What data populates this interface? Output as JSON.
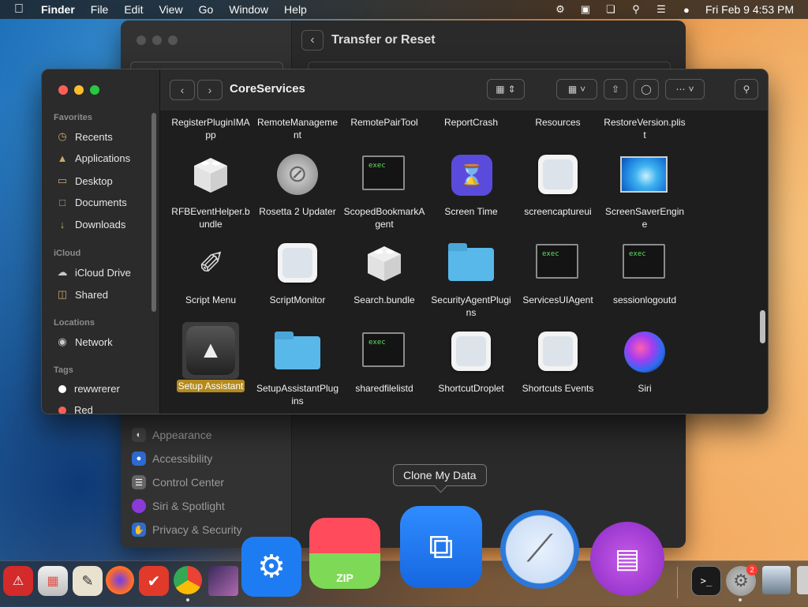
{
  "menubar": {
    "app": "Finder",
    "menus": [
      "File",
      "Edit",
      "View",
      "Go",
      "Window",
      "Help"
    ],
    "clock": "Fri Feb 9  4:53 PM"
  },
  "settings": {
    "title": "Transfer or Reset",
    "items": [
      "Appearance",
      "Accessibility",
      "Control Center",
      "Siri & Spotlight",
      "Privacy & Security"
    ]
  },
  "finder": {
    "title": "CoreServices",
    "sidebar": {
      "favorites_header": "Favorites",
      "favorites": [
        "Recents",
        "Applications",
        "Desktop",
        "Documents",
        "Downloads"
      ],
      "icloud_header": "iCloud",
      "icloud": [
        "iCloud Drive",
        "Shared"
      ],
      "locations_header": "Locations",
      "locations": [
        "Network"
      ],
      "tags_header": "Tags",
      "tags": [
        "rewwrerer",
        "Red"
      ]
    },
    "files_row0": [
      "RegisterPluginIMApp",
      "RemoteManagement",
      "RemotePairTool",
      "ReportCrash",
      "Resources",
      "RestoreVersion.plist"
    ],
    "files_row1": [
      "RFBEventHelper.bundle",
      "Rosetta 2 Updater",
      "ScopedBookmarkAgent",
      "Screen Time",
      "screencaptureui",
      "ScreenSaverEngine"
    ],
    "files_row2": [
      "Script Menu",
      "ScriptMonitor",
      "Search.bundle",
      "SecurityAgentPlugins",
      "ServicesUIAgent",
      "sessionlogoutd"
    ],
    "files_row3": [
      "Setup Assistant",
      "SetupAssistantPlugins",
      "sharedfilelistd",
      "ShortcutDroplet",
      "Shortcuts Events",
      "Siri"
    ],
    "exec_label": "exec",
    "selected": "Setup Assistant"
  },
  "tooltip": "Clone My Data",
  "dock": {
    "zip_label": "ZIP",
    "badge": "2"
  }
}
